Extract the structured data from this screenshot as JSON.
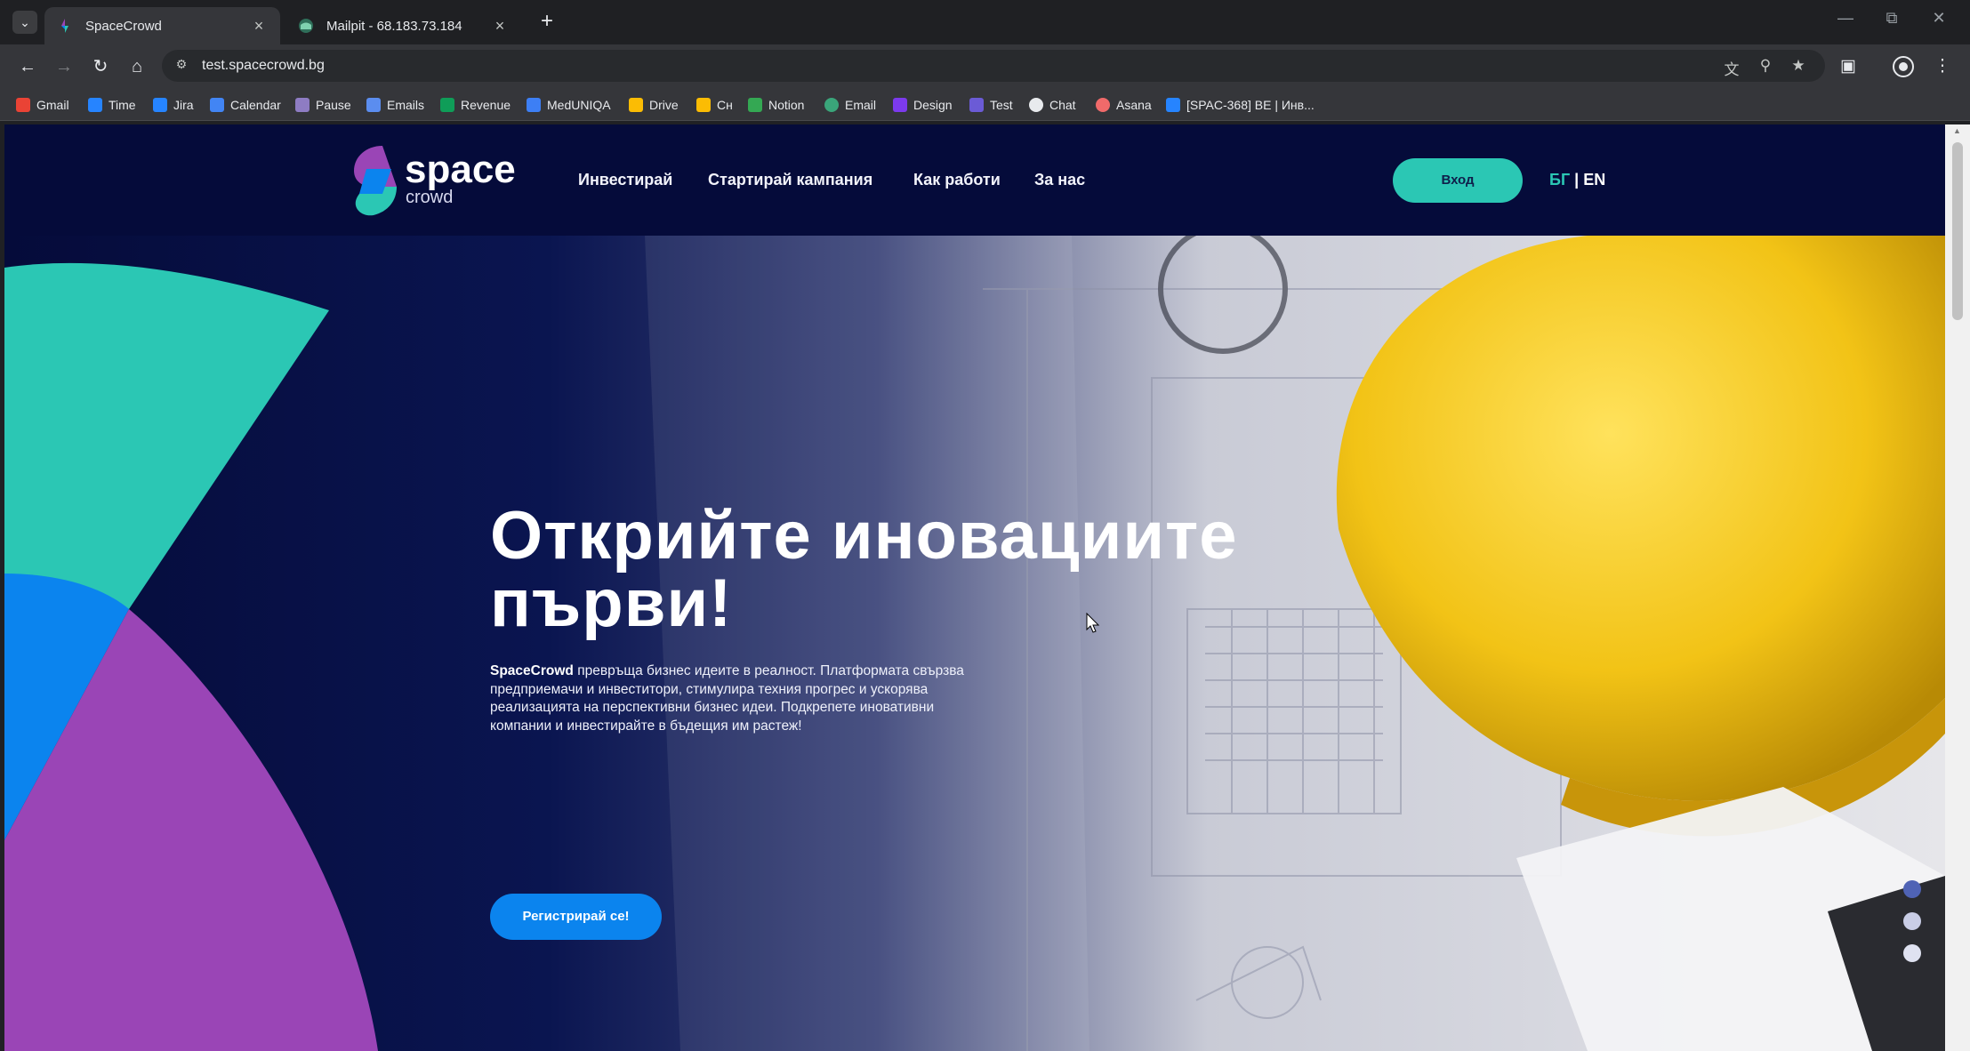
{
  "browser": {
    "tabs": [
      {
        "title": "SpaceCrowd",
        "active": true
      },
      {
        "title": "Mailpit - 68.183.73.184",
        "active": false
      }
    ],
    "url": "test.spacecrowd.bg",
    "bookmarks": [
      {
        "label": "Gmail",
        "icon": "gmail-icon",
        "color": "#ea4335"
      },
      {
        "label": "Time",
        "icon": "jira-icon",
        "color": "#2684ff"
      },
      {
        "label": "Jira",
        "icon": "jira-icon",
        "color": "#2684ff"
      },
      {
        "label": "Calendar",
        "icon": "calendar-icon",
        "color": "#4285f4"
      },
      {
        "label": "Pause",
        "icon": "pause-icon",
        "color": "#8e7cc3"
      },
      {
        "label": "Emails",
        "icon": "people-icon",
        "color": "#5b8def"
      },
      {
        "label": "Revenue",
        "icon": "sheets-icon",
        "color": "#0f9d58"
      },
      {
        "label": "MedUNIQA",
        "icon": "meduniqa-icon",
        "color": "#3d7ff5"
      },
      {
        "label": "Drive",
        "icon": "drive-icon",
        "color": "#fbbc04"
      },
      {
        "label": "Сн",
        "icon": "drive-icon",
        "color": "#fbbc04"
      },
      {
        "label": "Notion",
        "icon": "check-icon",
        "color": "#34a853"
      },
      {
        "label": "Email",
        "icon": "globe-icon",
        "color": "#3aa57a"
      },
      {
        "label": "Design",
        "icon": "design-icon",
        "color": "#7c3aed"
      },
      {
        "label": "Test",
        "icon": "spacecrowd-icon",
        "color": "#6b5bd6"
      },
      {
        "label": "Chat",
        "icon": "chat-icon",
        "color": "#e8eaed"
      },
      {
        "label": "Asana",
        "icon": "asana-icon",
        "color": "#f06a6a"
      },
      {
        "label": "[SPAC-368] BE | Инв...",
        "icon": "jira-icon",
        "color": "#2684ff"
      }
    ]
  },
  "site": {
    "logo_text": "space",
    "logo_sub": "crowd",
    "nav": [
      "Инвестирай",
      "Стартирай кампания",
      "Как работи",
      "За нас"
    ],
    "login": "Вход",
    "lang_bg": "БГ",
    "lang_sep": " | ",
    "lang_en": "EN"
  },
  "hero": {
    "title_line1": "Открийте иновациите",
    "title_line2": "първи!",
    "desc_brand": "SpaceCrowd",
    "desc_rest": " превръща бизнес идеите в реалност. Платформата свързва предприемачи и инвеститори, стимулира техния прогрес и ускорява реализацията на перспективни бизнес идеи. Подкрепете иновативни компании и инвестирайте в бъдещия им растеж!",
    "cta": "Регистрирай се!",
    "slider_active_index": 0
  },
  "colors": {
    "navy": "#050b3a",
    "teal": "#2bc7b4",
    "blue": "#0b84ee",
    "purple": "#9a45b6",
    "helmet": "#f2c316"
  }
}
